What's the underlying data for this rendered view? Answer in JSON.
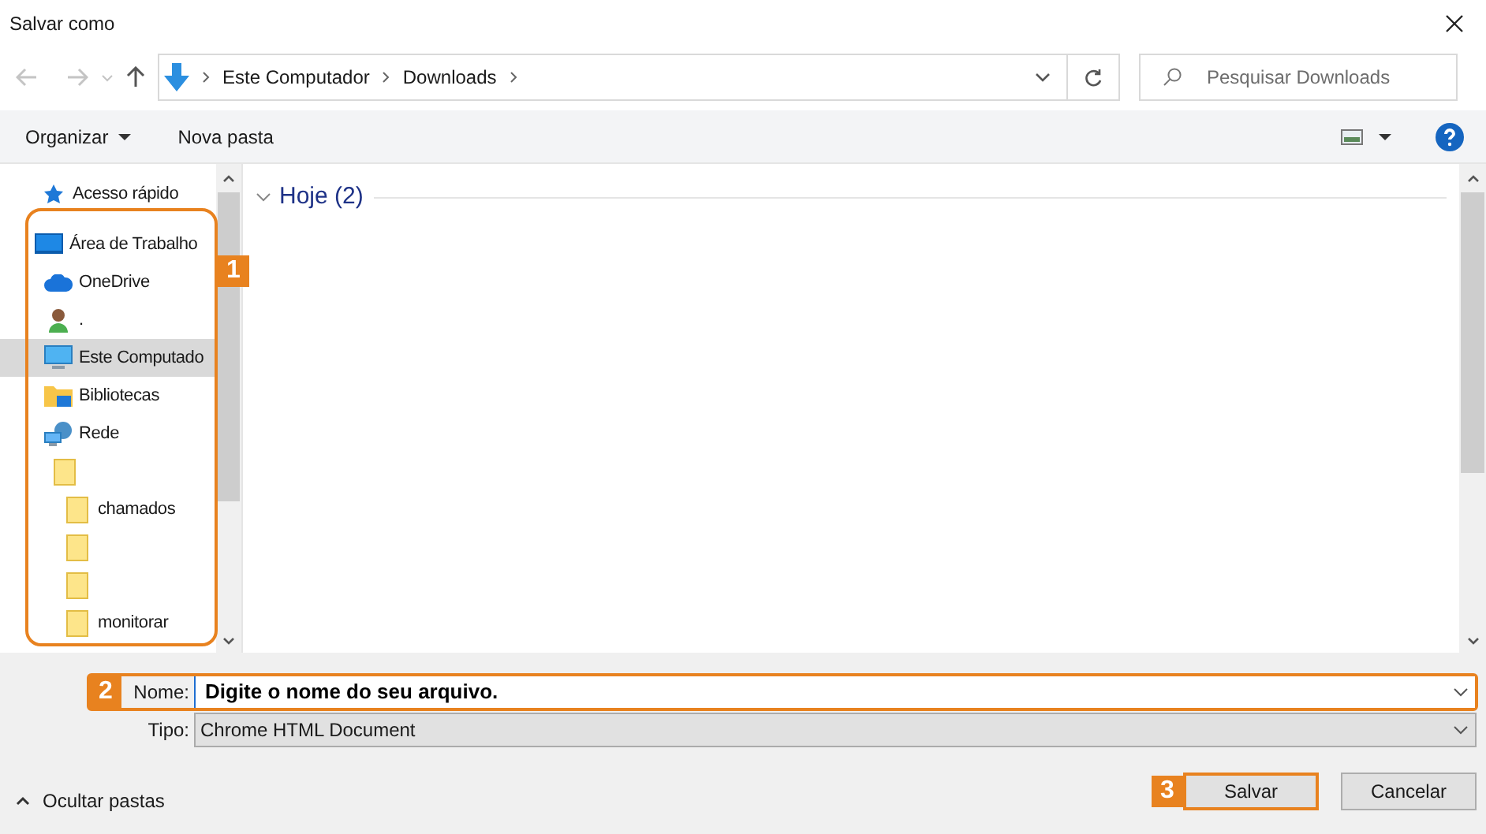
{
  "window": {
    "title": "Salvar como"
  },
  "address_bar": {
    "crumbs": [
      "Este Computador",
      "Downloads"
    ]
  },
  "search": {
    "placeholder": "Pesquisar Downloads"
  },
  "toolbar": {
    "organize": "Organizar",
    "new_folder": "Nova pasta"
  },
  "sidebar": {
    "items": [
      {
        "kind": "star",
        "label": "Acesso rápido",
        "selected": false
      },
      {
        "kind": "desktop",
        "label": "Área de Trabalho",
        "selected": false
      },
      {
        "kind": "cloud",
        "label": "OneDrive",
        "selected": false
      },
      {
        "kind": "user",
        "label": ".",
        "selected": false
      },
      {
        "kind": "computer",
        "label": "Este Computado",
        "selected": true
      },
      {
        "kind": "library",
        "label": "Bibliotecas",
        "selected": false
      },
      {
        "kind": "network",
        "label": "Rede",
        "selected": false
      },
      {
        "kind": "folder",
        "selected": false,
        "children": [
          {
            "kind": "folder",
            "label": "chamados",
            "selected": false
          },
          {
            "kind": "folder",
            "selected": false
          },
          {
            "kind": "folder",
            "selected": false
          },
          {
            "kind": "folder",
            "label": "monitorar",
            "selected": false
          }
        ]
      }
    ]
  },
  "content": {
    "group": {
      "label": "Hoje (2)",
      "expanded": true
    }
  },
  "form": {
    "name": {
      "label": "Nome:",
      "value": "Digite o nome do seu arquivo."
    },
    "type": {
      "label": "Tipo:",
      "value": "Chrome HTML Document"
    }
  },
  "footer": {
    "hide_folders": "Ocultar pastas",
    "buttons": [
      "Salvar",
      "Cancelar"
    ]
  },
  "annotations": [
    "1",
    "2",
    "3"
  ]
}
